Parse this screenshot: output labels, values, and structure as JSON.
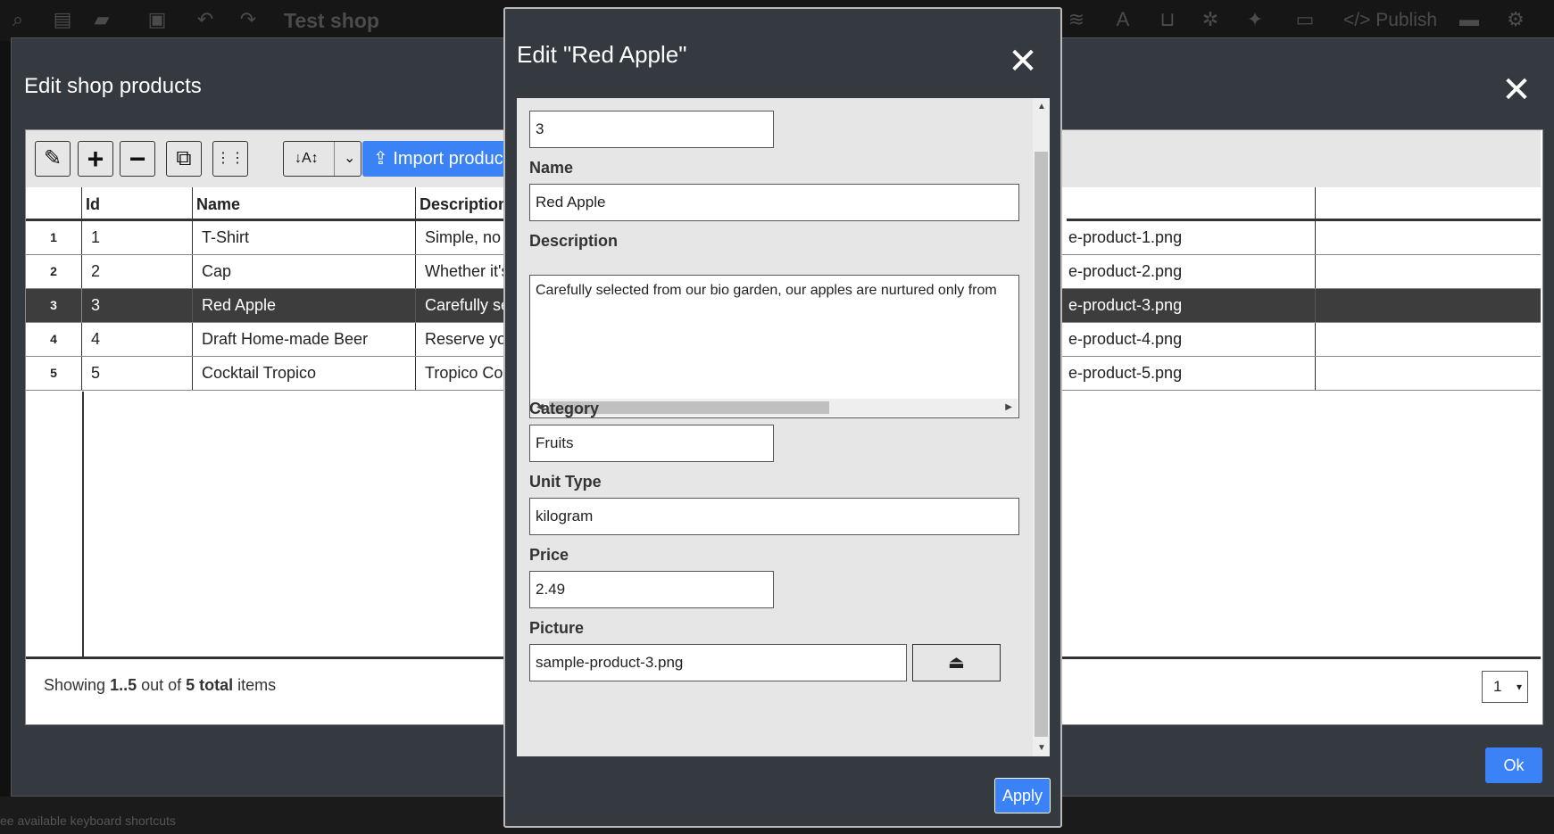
{
  "app": {
    "title": "Test shop",
    "publish_label": "</> Publish",
    "shortcuts_hint": "ee available keyboard shortcuts"
  },
  "products_dialog": {
    "title": "Edit shop products",
    "close_icon": "✕",
    "import_label": "Import products",
    "columns": [
      "Id",
      "Name",
      "Description"
    ],
    "rows": [
      {
        "num": "1",
        "id": "1",
        "name": "T-Shirt",
        "description": "Simple, no",
        "picture": "e-product-1.png"
      },
      {
        "num": "2",
        "id": "2",
        "name": "Cap",
        "description": "Whether it's",
        "picture": "e-product-2.png"
      },
      {
        "num": "3",
        "id": "3",
        "name": "Red Apple",
        "description": "Carefully se",
        "picture": "e-product-3.png"
      },
      {
        "num": "4",
        "id": "4",
        "name": "Draft Home-made Beer",
        "description": "Reserve yo",
        "picture": "e-product-4.png"
      },
      {
        "num": "5",
        "id": "5",
        "name": "Cocktail Tropico",
        "description": "Tropico Coc",
        "picture": "e-product-5.png"
      }
    ],
    "selected_row": "3",
    "footer": {
      "prefix": "Showing ",
      "range": "1..5",
      "middle": " out of ",
      "total": "5 total",
      "suffix": " items"
    },
    "page_value": "1",
    "page_arrow": "▾",
    "ok_label": "Ok"
  },
  "edit_dialog": {
    "title": "Edit \"Red Apple\"",
    "close_icon": "✕",
    "fields": {
      "id_value": "3",
      "name_label": "Name",
      "name_value": "Red Apple",
      "description_label": "Description",
      "description_value": "Carefully selected from our bio garden, our apples are nurtured only from",
      "category_label": "Category",
      "category_value": "Fruits",
      "unit_type_label": "Unit Type",
      "unit_type_value": "kilogram",
      "price_label": "Price",
      "price_value": "2.49",
      "picture_label": "Picture",
      "picture_value": "sample-product-3.png"
    },
    "apply_label": "Apply"
  },
  "icons": {
    "edit": "✎",
    "add": "+",
    "remove": "−",
    "duplicate": "⧉",
    "select": "⋮⋮",
    "sort": "↓A↕",
    "dropdown": "⌄",
    "upload": "⏏"
  }
}
